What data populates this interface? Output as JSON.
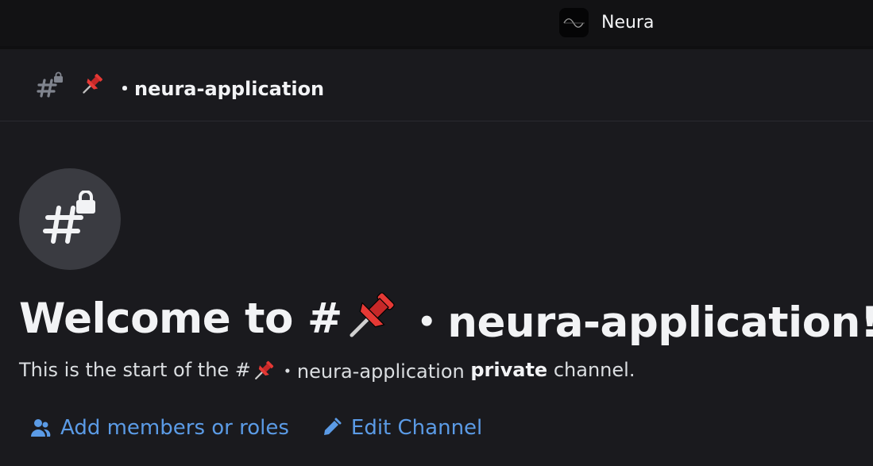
{
  "titlebar": {
    "server_name": "Neura",
    "server_icon": "neura-wave-icon"
  },
  "header": {
    "channel_icon": "hash-lock-icon",
    "emoji": "pushpin",
    "channel_name": "・neura-application"
  },
  "welcome": {
    "prefix": "Welcome to #",
    "channel_name": "・neura-application!",
    "subtitle_prefix": "This is the start of the #",
    "subtitle_channel": "・neura-application",
    "subtitle_bold": "private",
    "subtitle_suffix": "channel."
  },
  "actions": {
    "add_members_label": "Add members or roles",
    "edit_channel_label": "Edit Channel"
  },
  "colors": {
    "background": "#1a1a1e",
    "titlebar": "#121214",
    "link": "#5b9be6",
    "pin_red": "#e53935"
  }
}
